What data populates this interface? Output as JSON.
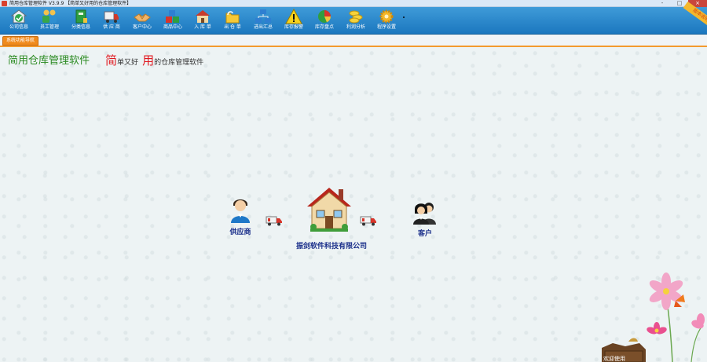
{
  "window": {
    "title": "简用仓库管理软件  V3.9.9 【简单又好用的仓库管理软件】",
    "min": "-",
    "max": "□",
    "close": "×"
  },
  "toolbar": {
    "items": [
      {
        "label": "公司信息",
        "icon": "company-check-icon"
      },
      {
        "label": "员工管理",
        "icon": "staff-icon"
      },
      {
        "label": "分类信息",
        "icon": "category-book-icon"
      },
      {
        "label": "供 应 商",
        "icon": "supplier-truck-icon"
      },
      {
        "label": "客户中心",
        "icon": "handshake-icon"
      },
      {
        "label": "商品中心",
        "icon": "cubes-icon"
      },
      {
        "label": "入 库 单",
        "icon": "warehouse-in-icon"
      },
      {
        "label": "出 仓 单",
        "icon": "folder-out-icon"
      },
      {
        "label": "进出汇总",
        "icon": "network-summary-icon"
      },
      {
        "label": "库存报警",
        "icon": "warning-icon"
      },
      {
        "label": "库存盘点",
        "icon": "pie-chart-icon"
      },
      {
        "label": "利润分析",
        "icon": "coins-icon"
      },
      {
        "label": "程序设置",
        "icon": "gear-icon"
      }
    ],
    "ribbon": "版本说明"
  },
  "tabs": {
    "active": "系统功能导航"
  },
  "main": {
    "headline": "简用仓库管理软件",
    "slogan": {
      "c1": "简",
      "t1": "单又好",
      "c2": "用",
      "t2": "的仓库管理软件"
    },
    "supplier_label": "供应商",
    "company_label": "振剑软件科技有限公司",
    "customer_label": "客户",
    "welcome": "欢迎使用"
  },
  "colors": {
    "toolbar": "#1f7cc4",
    "accent_orange": "#f08a1c",
    "headline_green": "#2a8a21",
    "slogan_red": "#e0181f",
    "label_blue": "#1a2f8a"
  }
}
